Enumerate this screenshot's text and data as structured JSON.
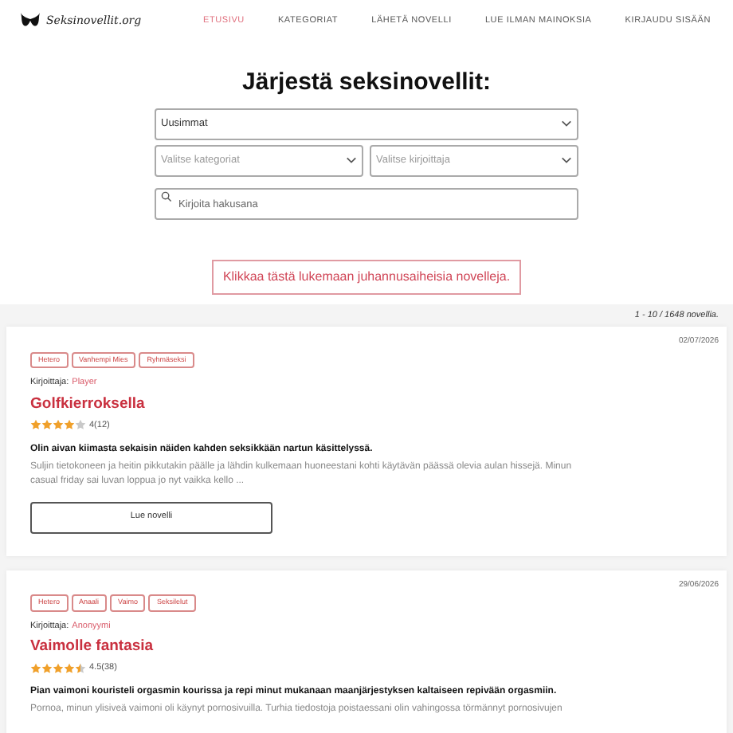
{
  "logo": {
    "text": "Seksinovellit.org"
  },
  "nav": [
    {
      "label": "ETUSIVU",
      "selected": true
    },
    {
      "label": "KATEGORIAT",
      "selected": false
    },
    {
      "label": "LÄHETÄ NOVELLI",
      "selected": false
    },
    {
      "label": "LUE ILMAN MAINOKSIA",
      "selected": false
    },
    {
      "label": "KIRJAUDU SISÄÄN",
      "selected": false
    }
  ],
  "heading": "Järjestä seksinovellit:",
  "sort_select": {
    "value": "Uusimmat"
  },
  "category_select": {
    "placeholder": "Valitse kategoriat"
  },
  "author_select": {
    "placeholder": "Valitse kirjoittaja"
  },
  "search": {
    "placeholder": "Kirjoita hakusana"
  },
  "promo_link": "Klikkaa tästä lukemaan juhannusaiheisia novelleja.",
  "count": "1 - 10 / 1648 novellia.",
  "stories": [
    {
      "date": "02/07/2026",
      "tags": [
        "Hetero",
        "Vanhempi Mies",
        "Ryhmäseksi"
      ],
      "author_label": "Kirjoittaja:",
      "author": "Player",
      "title": "Golfkierroksella",
      "stars": 4,
      "rating": "4(12)",
      "lead": "Olin aivan kiimasta sekaisin näiden kahden seksikkään nartun käsittelyssä.",
      "excerpt": "Suljin tietokoneen ja heitin pikkutakin päälle ja lähdin kulkemaan huoneestani kohti käytävän päässä olevia aulan hissejä. Minun casual friday sai luvan loppua jo nyt vaikka kello ...",
      "button": "Lue novelli"
    },
    {
      "date": "29/06/2026",
      "tags": [
        "Hetero",
        "Anaali",
        "Vaimo",
        "Seksilelut"
      ],
      "author_label": "Kirjoittaja:",
      "author": "Anonyymi",
      "title": "Vaimolle fantasia",
      "stars": 4.5,
      "rating": "4.5(38)",
      "lead": "Pian vaimoni kouristeli orgasmin kourissa ja repi minut mukanaan maanjärjestyksen kaltaiseen repivään orgasmiin.",
      "excerpt": "Pornoa, minun ylisiveä vaimoni oli käynyt pornosivuilla. Turhia tiedostoja poistaessani olin vahingossa törmännyt pornosivujen"
    }
  ]
}
